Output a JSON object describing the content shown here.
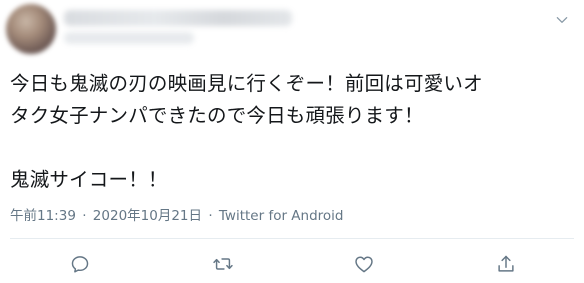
{
  "tweet": {
    "author": {
      "name_redacted": true,
      "avatar_icon": "user-avatar-icon"
    },
    "lines": [
      "今日も鬼滅の刃の映画見に行くぞー！前回は可愛いオ",
      "タク女子ナンパできたので今日も頑張ります！",
      "",
      "鬼滅サイコー！！"
    ],
    "meta": {
      "time": "午前11:39",
      "separator": "·",
      "date": "2020年10月21日",
      "source": "Twitter for Android"
    },
    "actions": {
      "reply_icon": "reply-icon",
      "retweet_icon": "retweet-icon",
      "like_icon": "heart-icon",
      "share_icon": "share-icon"
    },
    "colors": {
      "text": "#14171a",
      "secondary": "#657786",
      "divider": "#e6ecf0"
    }
  }
}
